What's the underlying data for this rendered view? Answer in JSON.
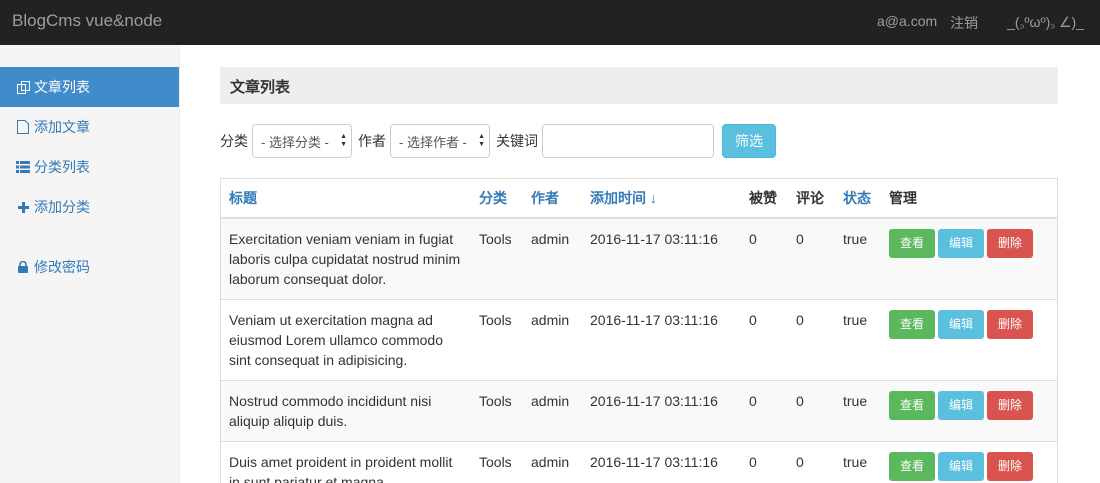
{
  "navbar": {
    "brand": "BlogCms vue&node",
    "user": "a@a.com",
    "logout": "注销",
    "emoticon": "_(꜆ºωº)꜆ ∠)_"
  },
  "sidebar": {
    "items": [
      {
        "label": "文章列表",
        "icon": "copy-icon",
        "active": true
      },
      {
        "label": "添加文章",
        "icon": "file-icon",
        "active": false
      },
      {
        "label": "分类列表",
        "icon": "list-icon",
        "active": false
      },
      {
        "label": "添加分类",
        "icon": "plus-icon",
        "active": false
      },
      {
        "label": "修改密码",
        "icon": "lock-icon",
        "active": false
      }
    ]
  },
  "main": {
    "title": "文章列表",
    "filter": {
      "category_label": "分类",
      "category_select": "- 选择分类 -",
      "author_label": "作者",
      "author_select": "- 选择作者 -",
      "keyword_label": "关键词",
      "keyword_value": "",
      "button": "筛选"
    },
    "table": {
      "headers": {
        "title": "标题",
        "category": "分类",
        "author": "作者",
        "added": "添加时间",
        "sort_icon": "↓",
        "likes": "被赞",
        "comments": "评论",
        "status": "状态",
        "manage": "管理"
      },
      "actions": {
        "view": "查看",
        "edit": "编辑",
        "delete": "删除"
      },
      "rows": [
        {
          "title": "Exercitation veniam veniam in fugiat laboris culpa cupidatat nostrud minim laborum consequat dolor.",
          "category": "Tools",
          "author": "admin",
          "added": "2016-11-17 03:11:16",
          "likes": "0",
          "comments": "0",
          "status": "true"
        },
        {
          "title": "Veniam ut exercitation magna ad eiusmod Lorem ullamco commodo sint consequat in adipisicing.",
          "category": "Tools",
          "author": "admin",
          "added": "2016-11-17 03:11:16",
          "likes": "0",
          "comments": "0",
          "status": "true"
        },
        {
          "title": "Nostrud commodo incididunt nisi aliquip aliquip duis.",
          "category": "Tools",
          "author": "admin",
          "added": "2016-11-17 03:11:16",
          "likes": "0",
          "comments": "0",
          "status": "true"
        },
        {
          "title": "Duis amet proident in proident mollit in sunt pariatur et magna.",
          "category": "Tools",
          "author": "admin",
          "added": "2016-11-17 03:11:16",
          "likes": "0",
          "comments": "0",
          "status": "true"
        }
      ]
    }
  },
  "colors": {
    "navbar_bg": "#222222",
    "active_item": "#428bca",
    "link": "#337ab7",
    "success": "#5cb85c",
    "info": "#5bc0de",
    "danger": "#d9534f"
  }
}
